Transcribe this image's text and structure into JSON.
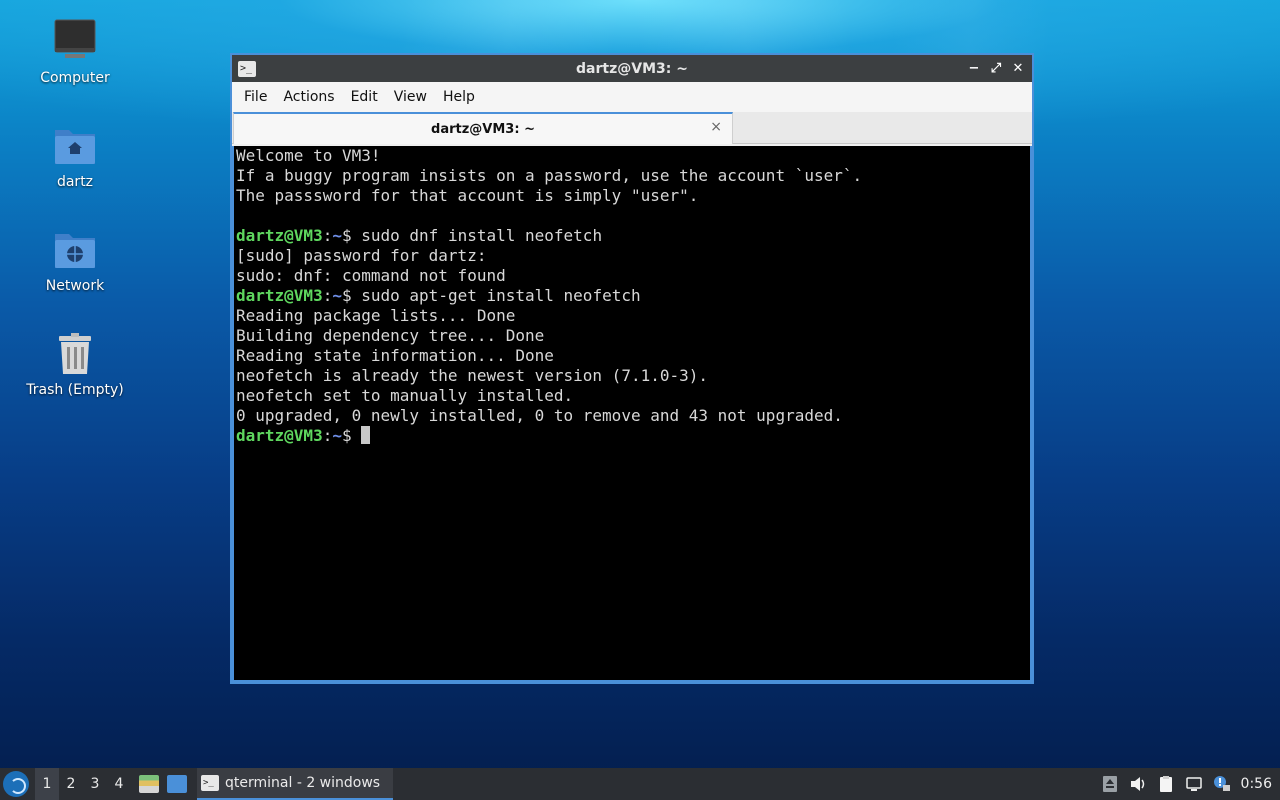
{
  "desktop": {
    "icons": [
      {
        "label": "Computer"
      },
      {
        "label": "dartz"
      },
      {
        "label": "Network"
      },
      {
        "label": "Trash (Empty)"
      }
    ]
  },
  "window": {
    "title": "dartz@VM3: ~",
    "controls": {
      "minimize": "−",
      "maximize": "⤢",
      "close": "✕"
    },
    "menu": [
      "File",
      "Actions",
      "Edit",
      "View",
      "Help"
    ],
    "tab": {
      "label": "dartz@VM3: ~",
      "close": "×"
    }
  },
  "terminal": {
    "lines": [
      {
        "type": "text",
        "text": "Welcome to VM3!"
      },
      {
        "type": "text",
        "text": "If a buggy program insists on a password, use the account `user`."
      },
      {
        "type": "text",
        "text": "The passsword for that account is simply \"user\"."
      },
      {
        "type": "text",
        "text": ""
      },
      {
        "type": "prompt",
        "user": "dartz@VM3",
        "sep": ":",
        "path": "~",
        "symbol": "$ ",
        "cmd": "sudo dnf install neofetch"
      },
      {
        "type": "text",
        "text": "[sudo] password for dartz:"
      },
      {
        "type": "text",
        "text": "sudo: dnf: command not found"
      },
      {
        "type": "prompt",
        "user": "dartz@VM3",
        "sep": ":",
        "path": "~",
        "symbol": "$ ",
        "cmd": "sudo apt-get install neofetch"
      },
      {
        "type": "text",
        "text": "Reading package lists... Done"
      },
      {
        "type": "text",
        "text": "Building dependency tree... Done"
      },
      {
        "type": "text",
        "text": "Reading state information... Done"
      },
      {
        "type": "text",
        "text": "neofetch is already the newest version (7.1.0-3)."
      },
      {
        "type": "text",
        "text": "neofetch set to manually installed."
      },
      {
        "type": "text",
        "text": "0 upgraded, 0 newly installed, 0 to remove and 43 not upgraded."
      },
      {
        "type": "prompt",
        "user": "dartz@VM3",
        "sep": ":",
        "path": "~",
        "symbol": "$ ",
        "cmd": "",
        "cursor": true
      }
    ]
  },
  "taskbar": {
    "workspaces": [
      "1",
      "2",
      "3",
      "4"
    ],
    "active_workspace": "1",
    "task_label": "qterminal - 2 windows",
    "clock": "0:56"
  },
  "colors": {
    "accent": "#4a90d9",
    "prompt_user": "#5fd75f",
    "prompt_path": "#6f8fe8"
  }
}
